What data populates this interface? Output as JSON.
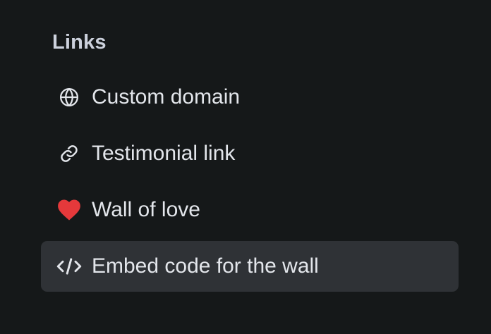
{
  "section": {
    "title": "Links"
  },
  "items": [
    {
      "label": "Custom domain",
      "icon": "globe-icon",
      "active": false
    },
    {
      "label": "Testimonial link",
      "icon": "link-icon",
      "active": false
    },
    {
      "label": "Wall of love",
      "icon": "heart-icon",
      "active": false
    },
    {
      "label": "Embed code for the wall",
      "icon": "code-icon",
      "active": true
    }
  ],
  "colors": {
    "background": "#151819",
    "active_background": "#2f3236",
    "text": "#e3e6eb",
    "heading": "#cdd2dd",
    "heart": "#e5393b"
  }
}
